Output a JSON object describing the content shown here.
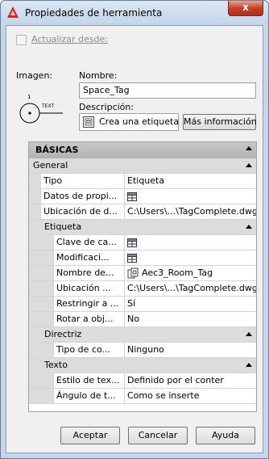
{
  "window": {
    "title": "Propiedades de herramienta",
    "close_glyph": "x"
  },
  "update_checkbox": {
    "label": "Actualizar desde:",
    "checked": false,
    "enabled": false
  },
  "image": {
    "label": "Imagen:",
    "preview": {
      "tag_letter": "1",
      "text_label": "TEXT"
    }
  },
  "name": {
    "label": "Nombre:",
    "value": "Space_Tag"
  },
  "description": {
    "label": "Descripción:",
    "value": "Crea una etiqueta d",
    "more_button": "Más información"
  },
  "grid": {
    "header": "BÁSICAS",
    "general": {
      "label": "General",
      "rows": [
        {
          "name": "Tipo",
          "value": "Etiqueta"
        },
        {
          "name": "Datos de propi...",
          "value": ""
        },
        {
          "name": "Ubicación de d...",
          "value": "C:\\Users\\...\\TagComplete.dwg"
        }
      ]
    },
    "etiqueta": {
      "label": "Etiqueta",
      "rows": [
        {
          "name": "Clave de ca...",
          "value": ""
        },
        {
          "name": "Modificaci...",
          "value": ""
        },
        {
          "name": "Nombre de...",
          "value": "Aec3_Room_Tag"
        },
        {
          "name": "Ubicación ...",
          "value": "C:\\Users\\...\\TagComplete.dwg"
        },
        {
          "name": "Restringir a ...",
          "value": "Sí"
        },
        {
          "name": "Rotar a obj...",
          "value": "No"
        }
      ]
    },
    "directriz": {
      "label": "Directriz",
      "rows": [
        {
          "name": "Tipo de co...",
          "value": "Ninguno"
        }
      ]
    },
    "texto": {
      "label": "Texto",
      "rows": [
        {
          "name": "Estilo de tex...",
          "value": "Definido por el conter"
        },
        {
          "name": "Ángulo de t...",
          "value": "Como se inserte"
        }
      ]
    }
  },
  "buttons": {
    "ok": "Aceptar",
    "cancel": "Cancelar",
    "help": "Ayuda"
  },
  "colors": {
    "title_bg": "#c3d5ea",
    "close": "#c7402a",
    "category_bg": "#dcdcdc",
    "header_bg": "#b9b9b9"
  }
}
